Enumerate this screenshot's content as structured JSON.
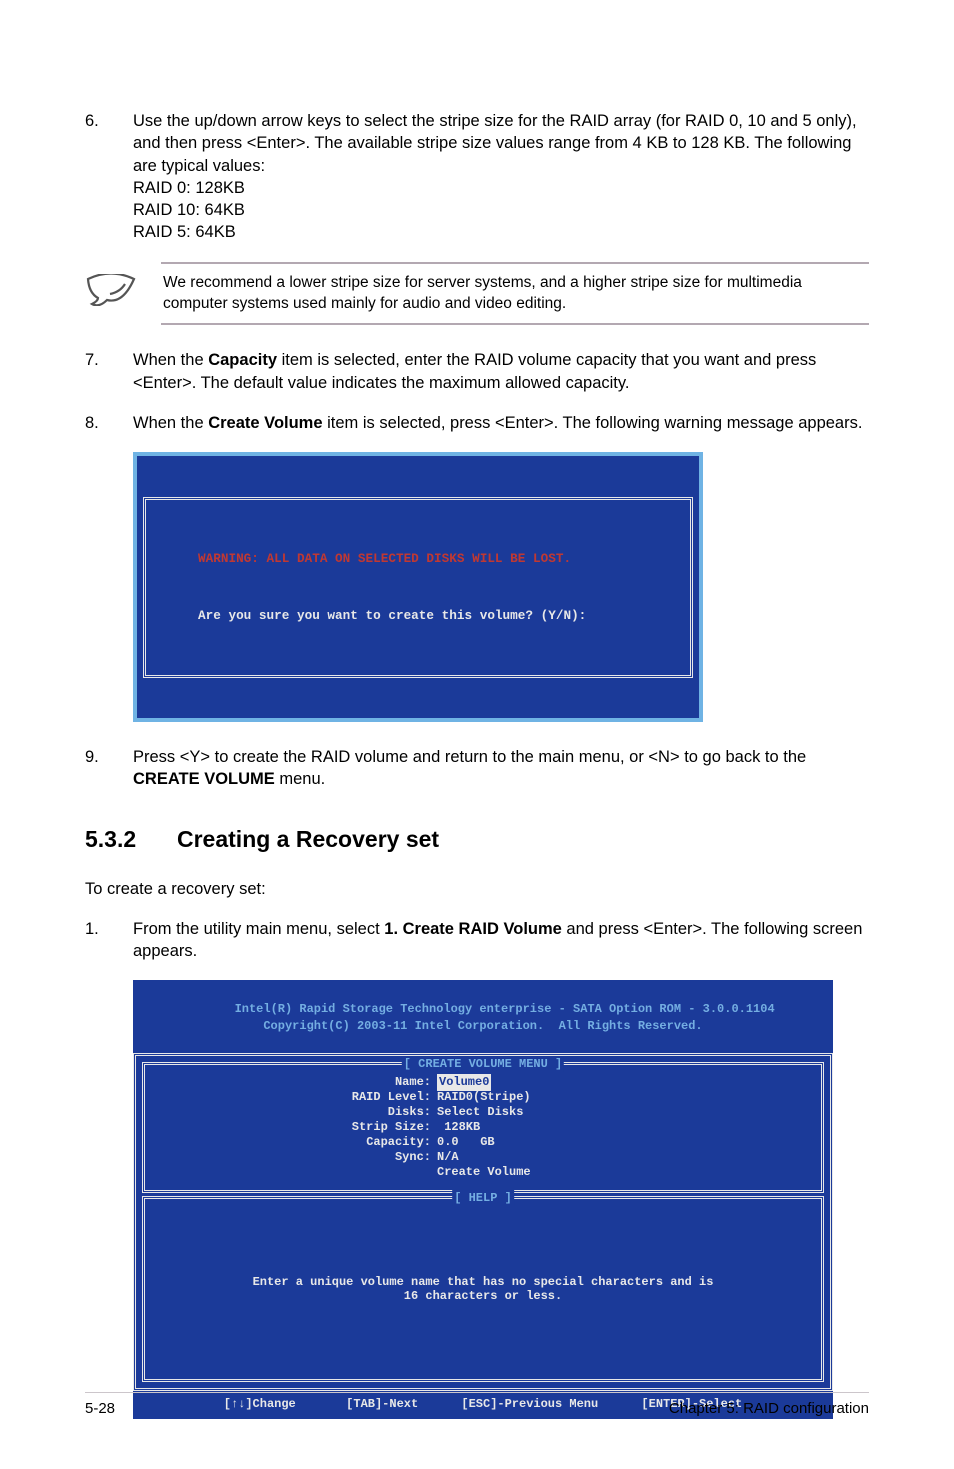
{
  "steps_top": [
    {
      "num": "6.",
      "text": "Use the up/down arrow keys to select the stripe size for the RAID array (for RAID 0, 10 and 5 only), and then press <Enter>. The available stripe size values range from 4 KB to 128 KB. The following are typical values:",
      "sub": [
        "RAID 0: 128KB",
        "RAID 10: 64KB",
        "RAID 5: 64KB"
      ]
    }
  ],
  "note_text": "We recommend a lower stripe size for server systems, and a higher stripe size for multimedia computer systems used mainly for audio and video editing.",
  "steps_mid": [
    {
      "num": "7.",
      "parts": [
        {
          "t": "When the "
        },
        {
          "t": "Capacity",
          "b": true
        },
        {
          "t": " item is selected, enter the RAID volume capacity that you want and press <Enter>. The default value indicates the maximum allowed capacity."
        }
      ]
    },
    {
      "num": "8.",
      "parts": [
        {
          "t": "When the "
        },
        {
          "t": "Create Volume",
          "b": true
        },
        {
          "t": " item is selected, press <Enter>. The following warning message appears."
        }
      ]
    }
  ],
  "warn": {
    "line1": "WARNING: ALL DATA ON SELECTED DISKS WILL BE LOST.",
    "line2": "Are you sure you want to create this volume? (Y/N):"
  },
  "step9": {
    "num": "9.",
    "parts": [
      {
        "t": "Press <Y> to create the RAID volume and return to the main menu, or <N> to go back to the "
      },
      {
        "t": "CREATE VOLUME",
        "b": true
      },
      {
        "t": " menu."
      }
    ]
  },
  "section": {
    "num": "5.3.2",
    "title": "Creating a Recovery set"
  },
  "intro": "To create a recovery set:",
  "step1b": {
    "num": "1.",
    "parts": [
      {
        "t": "From the utility main menu, select "
      },
      {
        "t": "1. Create RAID Volume",
        "b": true
      },
      {
        "t": " and press <Enter>. The following screen appears."
      }
    ]
  },
  "bios": {
    "head1": "Intel(R) Rapid Storage Technology enterprise - SATA Option ROM - 3.0.0.1104",
    "head2": "Copyright(C) 2003-11 Intel Corporation.  All Rights Reserved.",
    "panel1_title": "[ CREATE VOLUME MENU ]",
    "rows": [
      {
        "lbl": "Name:",
        "val": "Volume0",
        "hl": true,
        "trail": "          "
      },
      {
        "lbl": "RAID Level:",
        "val": "RAID0(Stripe)"
      },
      {
        "lbl": "Disks:",
        "val": "Select Disks"
      },
      {
        "lbl": "Strip Size:",
        "val": " 128KB"
      },
      {
        "lbl": "Capacity:",
        "val": "0.0   GB"
      },
      {
        "lbl": "Sync:",
        "val": "N/A"
      },
      {
        "lbl": "",
        "val": "Create Volume"
      }
    ],
    "panel2_title": "[ HELP ]",
    "help1": "Enter a unique volume name that has no special characters and is",
    "help2": "16 characters or less.",
    "foot": "[↑↓]Change       [TAB]-Next      [ESC]-Previous Menu      [ENTER]-Select"
  },
  "footer": {
    "left": "5-28",
    "right": "Chapter 5: RAID configuration"
  }
}
